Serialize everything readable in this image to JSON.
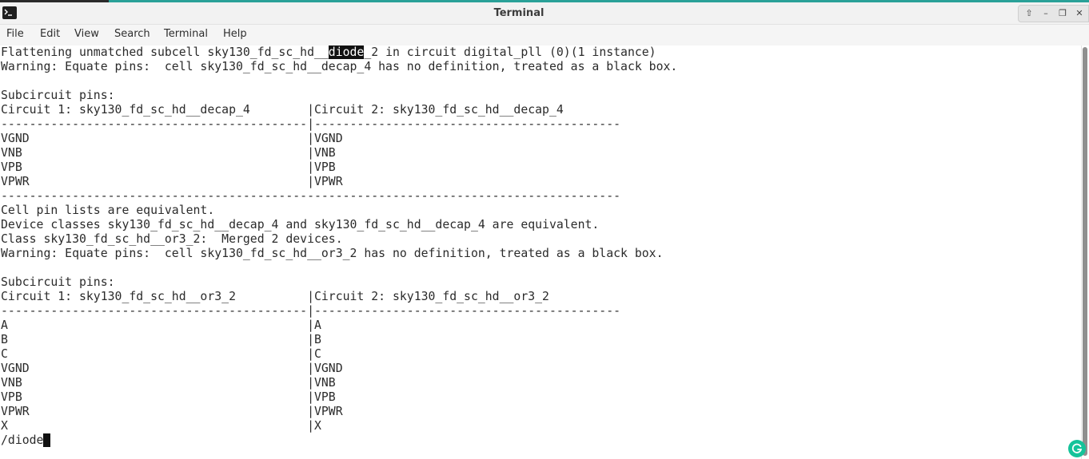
{
  "window": {
    "title": "Terminal",
    "controls": [
      "up-arrow",
      "minimize",
      "restore",
      "close"
    ],
    "control_glyphs": [
      "⇧",
      "–",
      "❐",
      "✕"
    ]
  },
  "menu": [
    "File",
    "Edit",
    "View",
    "Search",
    "Terminal",
    "Help"
  ],
  "terminal": {
    "highlight_line_pre": "Flattening unmatched subcell sky130_fd_sc_hd__",
    "highlight_text": "diode",
    "highlight_line_post": "_2 in circuit digital_pll (0)(1 instance)",
    "lines": [
      "Warning: Equate pins:  cell sky130_fd_sc_hd__decap_4 has no definition, treated as a black box.",
      "",
      "Subcircuit pins:",
      "Circuit 1: sky130_fd_sc_hd__decap_4        |Circuit 2: sky130_fd_sc_hd__decap_4",
      "-------------------------------------------|-------------------------------------------",
      "VGND                                       |VGND",
      "VNB                                        |VNB",
      "VPB                                        |VPB",
      "VPWR                                       |VPWR",
      "---------------------------------------------------------------------------------------",
      "Cell pin lists are equivalent.",
      "Device classes sky130_fd_sc_hd__decap_4 and sky130_fd_sc_hd__decap_4 are equivalent.",
      "Class sky130_fd_sc_hd__or3_2:  Merged 2 devices.",
      "Warning: Equate pins:  cell sky130_fd_sc_hd__or3_2 has no definition, treated as a black box.",
      "",
      "Subcircuit pins:",
      "Circuit 1: sky130_fd_sc_hd__or3_2          |Circuit 2: sky130_fd_sc_hd__or3_2",
      "-------------------------------------------|-------------------------------------------",
      "A                                          |A",
      "B                                          |B",
      "C                                          |C",
      "VGND                                       |VGND",
      "VNB                                        |VNB",
      "VPB                                        |VPB",
      "VPWR                                       |VPWR",
      "X                                          |X"
    ],
    "prompt": "/diode"
  },
  "colors": {
    "accent_strip": "#2aa198",
    "grammarly": "#15c39a",
    "text": "#2b2b2b"
  },
  "icons": {
    "app": "terminal-icon",
    "overlay": "grammarly-icon"
  }
}
